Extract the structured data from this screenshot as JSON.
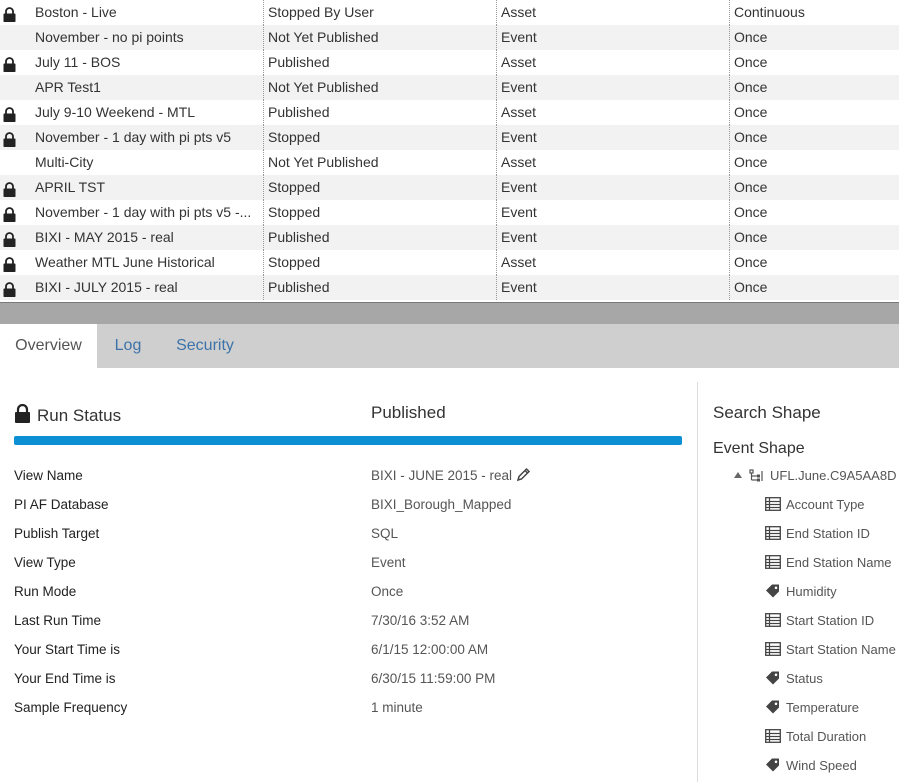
{
  "grid": {
    "rows": [
      {
        "locked": true,
        "name": "Boston - Live",
        "status": "Stopped By User",
        "type": "Asset",
        "mode": "Continuous"
      },
      {
        "locked": false,
        "name": "November - no pi points",
        "status": "Not Yet Published",
        "type": "Event",
        "mode": "Once"
      },
      {
        "locked": true,
        "name": "July 11 - BOS",
        "status": "Published",
        "type": "Asset",
        "mode": "Once"
      },
      {
        "locked": false,
        "name": "APR Test1",
        "status": "Not Yet Published",
        "type": "Event",
        "mode": "Once"
      },
      {
        "locked": true,
        "name": "July 9-10 Weekend - MTL",
        "status": "Published",
        "type": "Asset",
        "mode": "Once"
      },
      {
        "locked": true,
        "name": "November - 1 day with pi pts v5",
        "status": "Stopped",
        "type": "Event",
        "mode": "Once"
      },
      {
        "locked": false,
        "name": "Multi-City",
        "status": "Not Yet Published",
        "type": "Asset",
        "mode": "Once"
      },
      {
        "locked": true,
        "name": "APRIL TST",
        "status": "Stopped",
        "type": "Event",
        "mode": "Once"
      },
      {
        "locked": true,
        "name": "November - 1 day with pi pts v5 -...",
        "status": "Stopped",
        "type": "Event",
        "mode": "Once"
      },
      {
        "locked": true,
        "name": "BIXI - MAY 2015 - real",
        "status": "Published",
        "type": "Event",
        "mode": "Once"
      },
      {
        "locked": true,
        "name": "Weather MTL June Historical",
        "status": "Stopped",
        "type": "Asset",
        "mode": "Once"
      },
      {
        "locked": true,
        "name": "BIXI - JULY 2015 - real",
        "status": "Published",
        "type": "Event",
        "mode": "Once"
      }
    ]
  },
  "tabs": {
    "overview": "Overview",
    "log": "Log",
    "security": "Security"
  },
  "overview": {
    "run_status_label": "Run Status",
    "run_status_value": "Published",
    "progress_percent": 100,
    "progress_color": "#0d8fd3",
    "properties": [
      {
        "label": "View Name",
        "value": "BIXI - JUNE 2015 - real",
        "editable": true
      },
      {
        "label": "PI AF Database",
        "value": "BIXI_Borough_Mapped"
      },
      {
        "label": "Publish Target",
        "value": "SQL"
      },
      {
        "label": "View Type",
        "value": "Event"
      },
      {
        "label": "Run Mode",
        "value": "Once"
      },
      {
        "label": "Last Run Time",
        "value": "7/30/16 3:52 AM"
      },
      {
        "label": "Your Start Time is",
        "value": "6/1/15 12:00:00 AM"
      },
      {
        "label": "Your End Time is",
        "value": "6/30/15 11:59:00 PM"
      },
      {
        "label": "Sample Frequency",
        "value": "1 minute"
      }
    ]
  },
  "shape": {
    "search_title": "Search Shape",
    "event_title": "Event Shape",
    "root_label": "UFL.June.C9A5AA8D",
    "attributes": [
      {
        "label": "Account Type",
        "icon": "table-icon"
      },
      {
        "label": "End Station ID",
        "icon": "table-icon"
      },
      {
        "label": "End Station Name",
        "icon": "table-icon"
      },
      {
        "label": "Humidity",
        "icon": "tag-icon"
      },
      {
        "label": "Start Station ID",
        "icon": "table-icon"
      },
      {
        "label": "Start Station Name",
        "icon": "table-icon"
      },
      {
        "label": "Status",
        "icon": "tag-icon"
      },
      {
        "label": "Temperature",
        "icon": "tag-icon"
      },
      {
        "label": "Total Duration",
        "icon": "table-icon"
      },
      {
        "label": "Wind Speed",
        "icon": "tag-icon"
      }
    ]
  }
}
